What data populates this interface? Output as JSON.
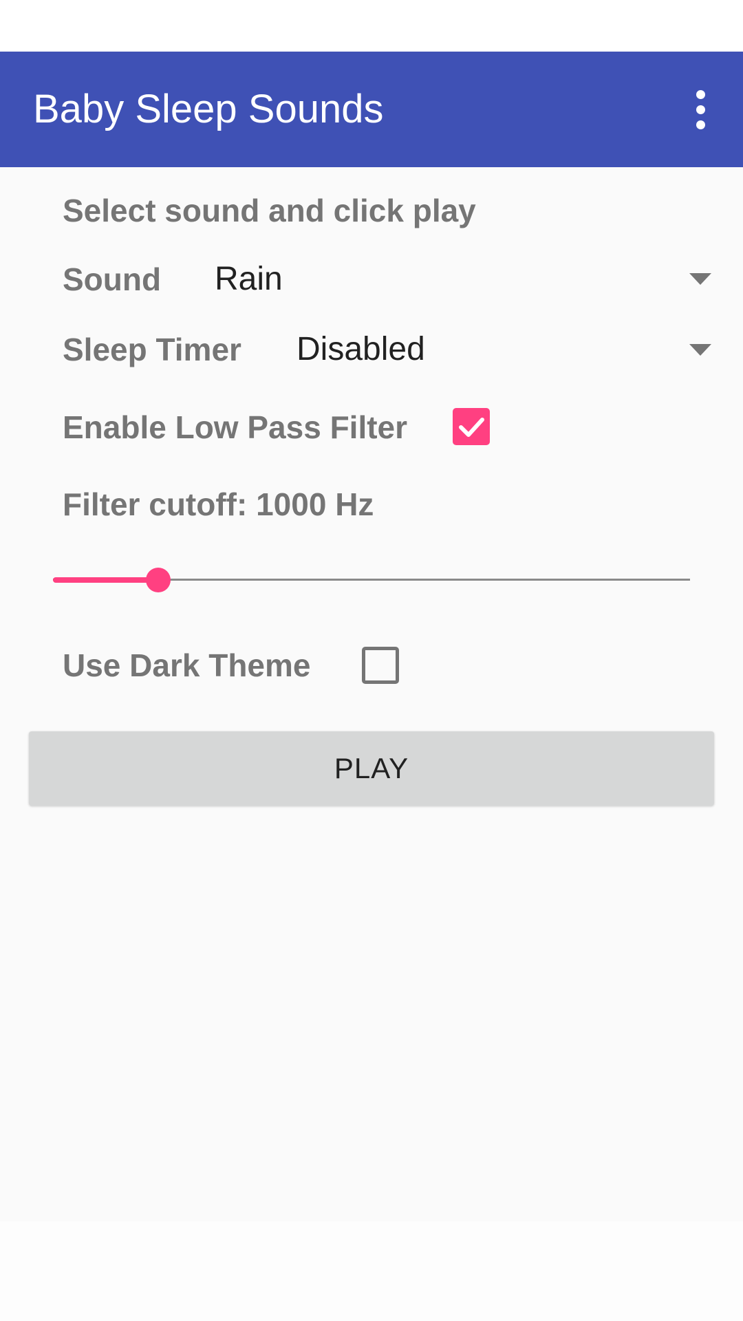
{
  "app_bar": {
    "title": "Baby Sleep Sounds",
    "overflow_icon": "more-vert-icon"
  },
  "form": {
    "instruction": "Select sound and click play",
    "sound": {
      "label": "Sound",
      "value": "Rain"
    },
    "sleep_timer": {
      "label": "Sleep Timer",
      "value": "Disabled"
    },
    "low_pass_filter": {
      "label": "Enable Low Pass Filter",
      "checked": true
    },
    "filter_cutoff": {
      "label": "Filter cutoff: 1000 Hz",
      "slider_fraction": 0.165
    },
    "dark_theme": {
      "label": "Use Dark Theme",
      "checked": false
    },
    "play_button": "PLAY"
  },
  "colors": {
    "primary": "#3f51b5",
    "accent": "#ff4081",
    "label_gray": "#757575"
  }
}
